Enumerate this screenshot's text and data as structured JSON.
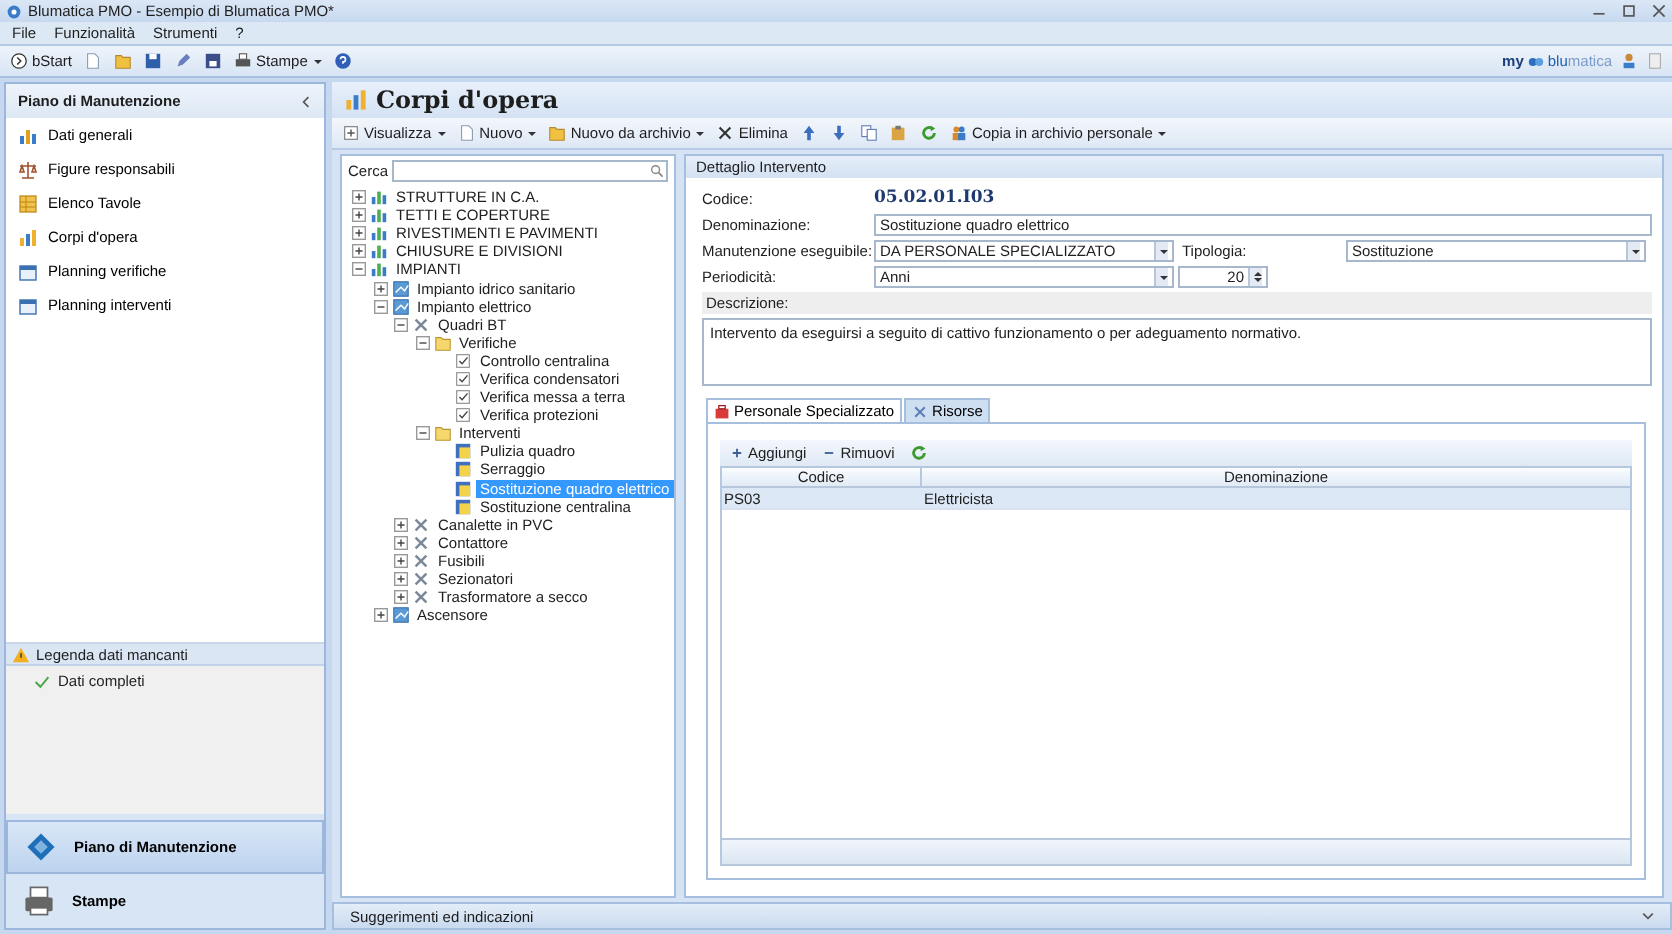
{
  "window": {
    "title": "Blumatica PMO - Esempio di Blumatica PMO*"
  },
  "menu": [
    "File",
    "Funzionalità",
    "Strumenti",
    "?"
  ],
  "main_toolbar": [
    {
      "kind": "start",
      "label": "bStart",
      "dropdown": false
    },
    {
      "kind": "new",
      "dropdown": false
    },
    {
      "kind": "open",
      "dropdown": false
    },
    {
      "kind": "save",
      "dropdown": false
    },
    {
      "kind": "edit",
      "dropdown": false
    },
    {
      "kind": "saveas",
      "dropdown": false
    },
    {
      "kind": "print",
      "label": "Stampe",
      "dropdown": true
    },
    {
      "kind": "help",
      "dropdown": false
    }
  ],
  "brand": {
    "prefix": "my",
    "name_1": "blu",
    "name_2": "matica"
  },
  "sidebar": {
    "title": "Piano di Manutenzione",
    "items": [
      {
        "label": "Dati generali",
        "kind": "chart",
        "selected": false
      },
      {
        "label": "Figure responsabili",
        "kind": "scales",
        "selected": false
      },
      {
        "label": "Elenco Tavole",
        "kind": "tables",
        "selected": false
      },
      {
        "label": "Corpi d'opera",
        "kind": "parts",
        "selected": false
      },
      {
        "label": "Planning verifiche",
        "kind": "planning",
        "selected": false
      },
      {
        "label": "Planning interventi",
        "kind": "planning",
        "selected": false
      }
    ],
    "legend": {
      "title": "Legenda dati mancanti",
      "items": [
        "Dati completi"
      ]
    },
    "modules": [
      {
        "label": "Piano di Manutenzione",
        "kind": "plan",
        "selected": true
      },
      {
        "label": "Stampe",
        "kind": "printer",
        "selected": false
      }
    ]
  },
  "content": {
    "title": "Corpi d'opera",
    "toolbar": [
      {
        "kind": "view",
        "label": "Visualizza",
        "dropdown": true
      },
      {
        "kind": "new",
        "label": "Nuovo",
        "dropdown": true
      },
      {
        "kind": "open",
        "label": "Nuovo da archivio",
        "dropdown": true
      },
      {
        "kind": "delete",
        "label": "Elimina",
        "dropdown": false
      },
      {
        "kind": "up",
        "dropdown": false
      },
      {
        "kind": "down",
        "dropdown": false
      },
      {
        "kind": "copy",
        "dropdown": false
      },
      {
        "kind": "paste",
        "dropdown": false
      },
      {
        "kind": "refresh",
        "dropdown": false
      },
      {
        "kind": "archive",
        "label": "Copia in archivio personale",
        "dropdown": true
      }
    ]
  },
  "search": {
    "label": "Cerca"
  },
  "tree": [
    {
      "label": "STRUTTURE IN C.A.",
      "kind": "group",
      "expanded": false,
      "selected": false
    },
    {
      "label": "TETTI E COPERTURE",
      "kind": "group",
      "expanded": false,
      "selected": false
    },
    {
      "label": "RIVESTIMENTI E PAVIMENTI",
      "kind": "group",
      "expanded": false,
      "selected": false
    },
    {
      "label": "CHIUSURE E DIVISIONI",
      "kind": "group",
      "expanded": false,
      "selected": false
    },
    {
      "label": "IMPIANTI",
      "kind": "group",
      "expanded": true,
      "selected": false,
      "children": [
        {
          "label": "Impianto idrico sanitario",
          "kind": "system",
          "expanded": false,
          "selected": false
        },
        {
          "label": "Impianto elettrico",
          "kind": "system",
          "expanded": true,
          "selected": false,
          "children": [
            {
              "label": "Quadri BT",
              "kind": "tool",
              "expanded": true,
              "selected": false,
              "children": [
                {
                  "label": "Verifiche",
                  "kind": "folder",
                  "expanded": true,
                  "selected": false,
                  "children": [
                    {
                      "label": "Controllo centralina",
                      "kind": "check",
                      "selected": false
                    },
                    {
                      "label": "Verifica condensatori",
                      "kind": "check",
                      "selected": false
                    },
                    {
                      "label": "Verifica messa a terra",
                      "kind": "check",
                      "selected": false
                    },
                    {
                      "label": "Verifica protezioni",
                      "kind": "check",
                      "selected": false
                    }
                  ]
                },
                {
                  "label": "Interventi",
                  "kind": "folder",
                  "expanded": true,
                  "selected": false,
                  "children": [
                    {
                      "label": "Pulizia quadro",
                      "kind": "task",
                      "selected": false
                    },
                    {
                      "label": "Serraggio",
                      "kind": "task",
                      "selected": false
                    },
                    {
                      "label": "Sostituzione quadro elettrico",
                      "kind": "task",
                      "selected": true
                    },
                    {
                      "label": "Sostituzione centralina",
                      "kind": "task",
                      "selected": false
                    }
                  ]
                }
              ]
            },
            {
              "label": "Canalette in PVC",
              "kind": "tool",
              "expanded": false,
              "selected": false
            },
            {
              "label": "Contattore",
              "kind": "tool",
              "expanded": false,
              "selected": false
            },
            {
              "label": "Fusibili",
              "kind": "tool",
              "expanded": false,
              "selected": false
            },
            {
              "label": "Sezionatori",
              "kind": "tool",
              "expanded": false,
              "selected": false
            },
            {
              "label": "Trasformatore a secco",
              "kind": "tool",
              "expanded": false,
              "selected": false
            }
          ]
        },
        {
          "label": "Ascensore",
          "kind": "system",
          "expanded": false,
          "selected": false
        }
      ]
    }
  ],
  "detail": {
    "title": "Dettaglio Intervento",
    "code": {
      "label": "Codice:",
      "value": "05.02.01.I03"
    },
    "name": {
      "label": "Denominazione:",
      "value": "Sostituzione quadro elettrico"
    },
    "maintenance": {
      "label": "Manutenzione eseguibile:",
      "value": "DA PERSONALE SPECIALIZZATO"
    },
    "type": {
      "label": "Tipologia:",
      "value": "Sostituzione"
    },
    "period": {
      "label": "Periodicità:",
      "value": "Anni",
      "count": "20"
    },
    "description": {
      "label": "Descrizione:",
      "value": "Intervento da eseguirsi a seguito di cattivo funzionamento o per adeguamento normativo."
    },
    "tabs": [
      {
        "label": "Personale Specializzato",
        "kind": "staff",
        "selected": true
      },
      {
        "label": "Risorse",
        "kind": "resources",
        "selected": false
      }
    ],
    "grid": {
      "actions": [
        {
          "kind": "add",
          "label": "Aggiungi"
        },
        {
          "kind": "remove",
          "label": "Rimuovi"
        },
        {
          "kind": "refresh"
        }
      ],
      "columns": [
        "Codice",
        "Denominazione"
      ],
      "rows": [
        {
          "cells": [
            "PS03",
            "Elettricista"
          ],
          "selected": true
        }
      ]
    }
  },
  "status_bar": {
    "text": "Suggerimenti ed indicazioni"
  }
}
